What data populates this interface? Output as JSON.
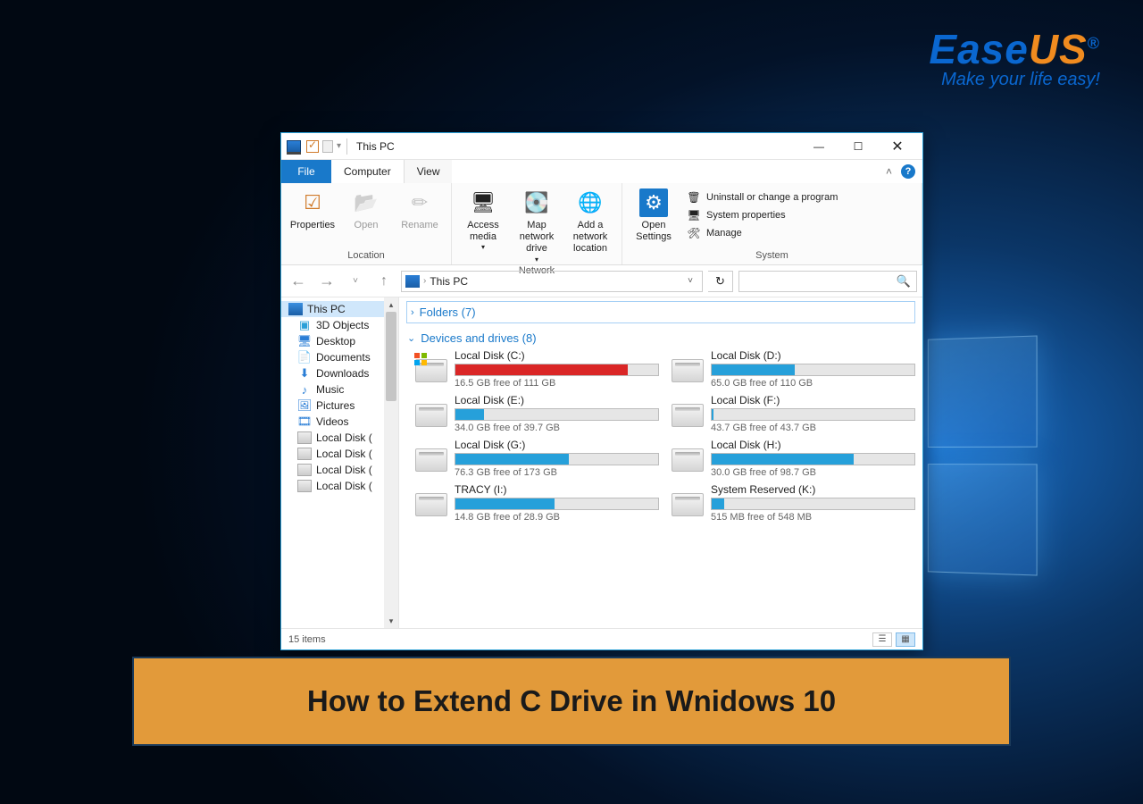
{
  "brand": {
    "ease": "Ease",
    "us": "US",
    "reg": "®",
    "tagline": "Make your life easy!"
  },
  "banner": "How to Extend C Drive in Wnidows 10",
  "titlebar": {
    "title": "This PC"
  },
  "tabs": {
    "file": "File",
    "computer": "Computer",
    "view": "View"
  },
  "ribbon": {
    "location": {
      "properties": "Properties",
      "open": "Open",
      "rename": "Rename",
      "label": "Location"
    },
    "network": {
      "access": "Access media",
      "map": "Map network drive",
      "add": "Add a network location",
      "label": "Network"
    },
    "system": {
      "open_settings": "Open Settings",
      "uninstall": "Uninstall or change a program",
      "props": "System properties",
      "manage": "Manage",
      "label": "System"
    }
  },
  "address": {
    "path": "This PC"
  },
  "sidebar": {
    "items": [
      {
        "label": "This PC",
        "icon": "pc",
        "top": true
      },
      {
        "label": "3D Objects",
        "icon": "cube"
      },
      {
        "label": "Desktop",
        "icon": "desktop"
      },
      {
        "label": "Documents",
        "icon": "doc"
      },
      {
        "label": "Downloads",
        "icon": "down"
      },
      {
        "label": "Music",
        "icon": "music"
      },
      {
        "label": "Pictures",
        "icon": "pic"
      },
      {
        "label": "Videos",
        "icon": "vid"
      },
      {
        "label": "Local Disk (",
        "icon": "drive"
      },
      {
        "label": "Local Disk (",
        "icon": "drive"
      },
      {
        "label": "Local Disk (",
        "icon": "drive"
      },
      {
        "label": "Local Disk (",
        "icon": "drive"
      }
    ]
  },
  "sections": {
    "folders": "Folders (7)",
    "devices": "Devices and drives (8)"
  },
  "drives": [
    {
      "name": "Local Disk (C:)",
      "free": "16.5 GB free of 111 GB",
      "pct": 85,
      "red": true,
      "win": true
    },
    {
      "name": "Local Disk (D:)",
      "free": "65.0 GB free of 110 GB",
      "pct": 41,
      "red": false
    },
    {
      "name": "Local Disk (E:)",
      "free": "34.0 GB free of 39.7 GB",
      "pct": 14,
      "red": false
    },
    {
      "name": "Local Disk (F:)",
      "free": "43.7 GB free of 43.7 GB",
      "pct": 1,
      "red": false
    },
    {
      "name": "Local Disk (G:)",
      "free": "76.3 GB free of 173 GB",
      "pct": 56,
      "red": false
    },
    {
      "name": "Local Disk (H:)",
      "free": "30.0 GB free of 98.7 GB",
      "pct": 70,
      "red": false
    },
    {
      "name": "TRACY (I:)",
      "free": "14.8 GB free of 28.9 GB",
      "pct": 49,
      "red": false
    },
    {
      "name": "System Reserved (K:)",
      "free": "515 MB free of 548 MB",
      "pct": 6,
      "red": false
    }
  ],
  "status": {
    "items": "15 items"
  }
}
